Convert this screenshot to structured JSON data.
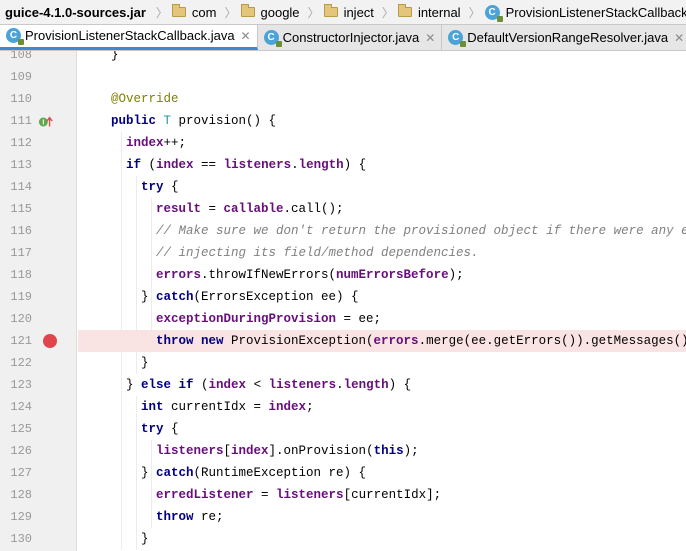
{
  "breadcrumb": {
    "jar": "guice-4.1.0-sources.jar",
    "items": [
      "com",
      "google",
      "inject",
      "internal"
    ],
    "current": "ProvisionListenerStackCallback"
  },
  "tabs": [
    {
      "label": "ProvisionListenerStackCallback.java",
      "close": "✕",
      "active": true
    },
    {
      "label": "ConstructorInjector.java",
      "close": "✕",
      "active": false
    },
    {
      "label": "DefaultVersionRangeResolver.java",
      "close": "✕",
      "active": false
    }
  ],
  "editor": {
    "breakpoint_line": "121",
    "line_numbers": [
      "108",
      "109",
      "110",
      "111",
      "112",
      "113",
      "114",
      "115",
      "116",
      "117",
      "118",
      "119",
      "120",
      "121",
      "122",
      "123",
      "124",
      "125",
      "126",
      "127",
      "128",
      "129",
      "130"
    ],
    "lines": [
      [
        [
          "plain",
          "}"
        ]
      ],
      [],
      [
        [
          "ann",
          "@Override"
        ]
      ],
      [
        [
          "kw",
          "public "
        ],
        [
          "type",
          "T "
        ],
        [
          "plain",
          "provision() {"
        ]
      ],
      [
        [
          "field",
          "index"
        ],
        [
          "plain",
          "++;"
        ]
      ],
      [
        [
          "kw",
          "if "
        ],
        [
          "plain",
          "("
        ],
        [
          "field",
          "index"
        ],
        [
          "plain",
          " == "
        ],
        [
          "field",
          "listeners"
        ],
        [
          "plain",
          "."
        ],
        [
          "field",
          "length"
        ],
        [
          "plain",
          ") {"
        ]
      ],
      [
        [
          "kw",
          "try "
        ],
        [
          "plain",
          "{"
        ]
      ],
      [
        [
          "field",
          "result"
        ],
        [
          "plain",
          " = "
        ],
        [
          "field",
          "callable"
        ],
        [
          "plain",
          ".call();"
        ]
      ],
      [
        [
          "cmt",
          "// Make sure we don't return the provisioned object if there were any errors"
        ]
      ],
      [
        [
          "cmt",
          "// injecting its field/method dependencies."
        ]
      ],
      [
        [
          "field",
          "errors"
        ],
        [
          "plain",
          ".throwIfNewErrors("
        ],
        [
          "field",
          "numErrorsBefore"
        ],
        [
          "plain",
          ");"
        ]
      ],
      [
        [
          "plain",
          "} "
        ],
        [
          "kw",
          "catch"
        ],
        [
          "plain",
          "(ErrorsException ee) {"
        ]
      ],
      [
        [
          "field",
          "exceptionDuringProvision"
        ],
        [
          "plain",
          " = ee;"
        ]
      ],
      [
        [
          "kw",
          "throw new "
        ],
        [
          "plain",
          "ProvisionException("
        ],
        [
          "field",
          "errors"
        ],
        [
          "plain",
          ".merge(ee.getErrors()).getMessages());"
        ]
      ],
      [
        [
          "plain",
          "}"
        ]
      ],
      [
        [
          "plain",
          "} "
        ],
        [
          "kw",
          "else if "
        ],
        [
          "plain",
          "("
        ],
        [
          "field",
          "index"
        ],
        [
          "plain",
          " < "
        ],
        [
          "field",
          "listeners"
        ],
        [
          "plain",
          "."
        ],
        [
          "field",
          "length"
        ],
        [
          "plain",
          ") {"
        ]
      ],
      [
        [
          "kw",
          "int "
        ],
        [
          "plain",
          "currentIdx = "
        ],
        [
          "field",
          "index"
        ],
        [
          "plain",
          ";"
        ]
      ],
      [
        [
          "kw",
          "try "
        ],
        [
          "plain",
          "{"
        ]
      ],
      [
        [
          "field",
          "listeners"
        ],
        [
          "plain",
          "["
        ],
        [
          "field",
          "index"
        ],
        [
          "plain",
          "].onProvision("
        ],
        [
          "kw",
          "this"
        ],
        [
          "plain",
          ");"
        ]
      ],
      [
        [
          "plain",
          "} "
        ],
        [
          "kw",
          "catch"
        ],
        [
          "plain",
          "(RuntimeException re) {"
        ]
      ],
      [
        [
          "field",
          "erredListener"
        ],
        [
          "plain",
          " = "
        ],
        [
          "field",
          "listeners"
        ],
        [
          "plain",
          "[currentIdx];"
        ]
      ],
      [
        [
          "kw",
          "throw "
        ],
        [
          "plain",
          "re;"
        ]
      ],
      [
        [
          "plain",
          "}"
        ]
      ]
    ]
  }
}
